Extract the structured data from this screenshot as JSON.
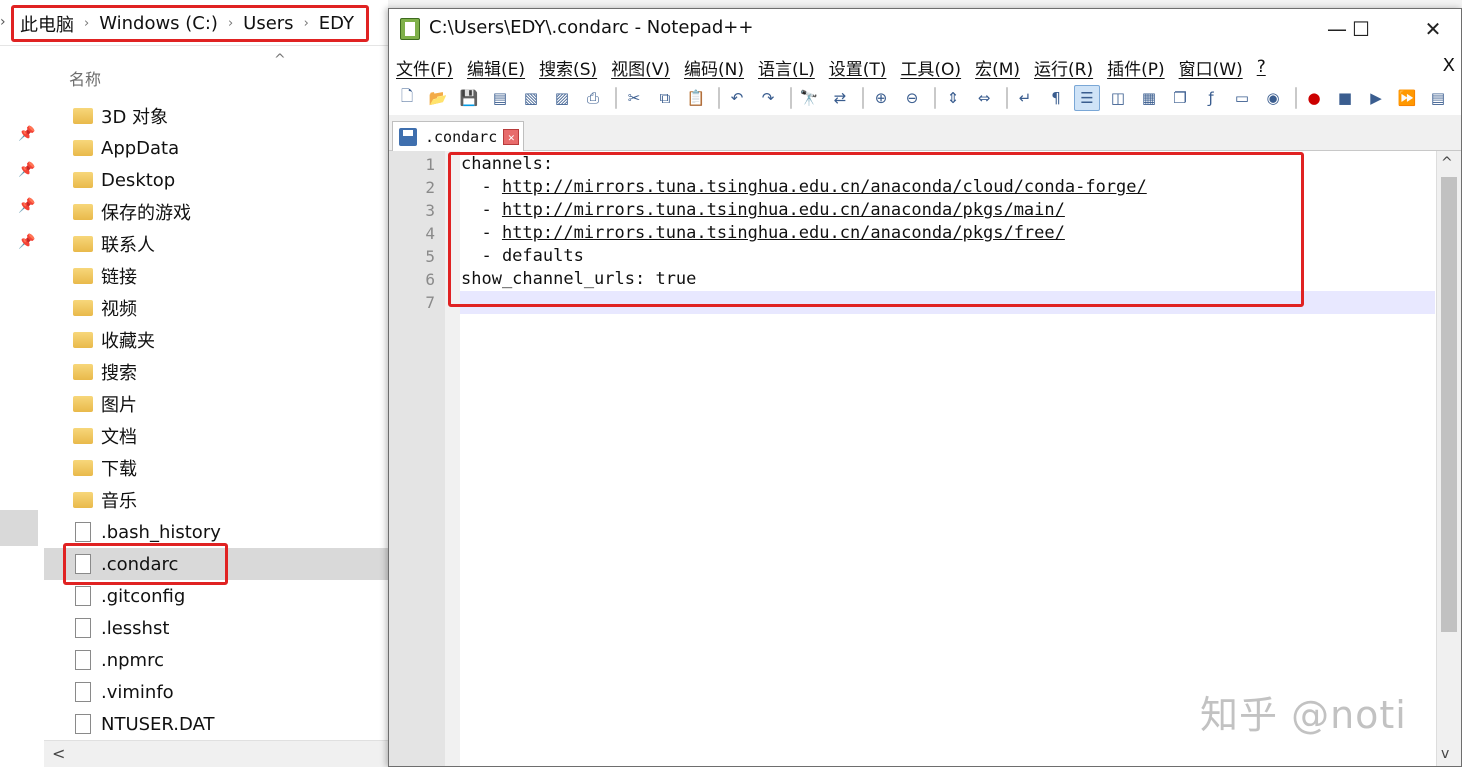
{
  "explorer": {
    "breadcrumb": [
      "此电脑",
      "Windows (C:)",
      "Users",
      "EDY"
    ],
    "column_header": "名称",
    "files": [
      {
        "name": "3D 对象",
        "icon": "3d-objects-folder-icon"
      },
      {
        "name": "AppData",
        "icon": "folder-icon"
      },
      {
        "name": "Desktop",
        "icon": "desktop-folder-icon"
      },
      {
        "name": "保存的游戏",
        "icon": "saved-games-folder-icon"
      },
      {
        "name": "联系人",
        "icon": "contacts-folder-icon"
      },
      {
        "name": "链接",
        "icon": "links-folder-icon"
      },
      {
        "name": "视频",
        "icon": "videos-folder-icon"
      },
      {
        "name": "收藏夹",
        "icon": "favorites-folder-icon"
      },
      {
        "name": "搜索",
        "icon": "searches-folder-icon"
      },
      {
        "name": "图片",
        "icon": "pictures-folder-icon"
      },
      {
        "name": "文档",
        "icon": "documents-folder-icon"
      },
      {
        "name": "下载",
        "icon": "downloads-folder-icon"
      },
      {
        "name": "音乐",
        "icon": "music-folder-icon"
      },
      {
        "name": ".bash_history",
        "icon": "file-icon"
      },
      {
        "name": ".condarc",
        "icon": "file-icon",
        "selected": true
      },
      {
        "name": ".gitconfig",
        "icon": "file-icon"
      },
      {
        "name": ".lesshst",
        "icon": "file-icon"
      },
      {
        "name": ".npmrc",
        "icon": "file-icon"
      },
      {
        "name": ".viminfo",
        "icon": "file-icon"
      },
      {
        "name": "NTUSER.DAT",
        "icon": "file-icon"
      }
    ]
  },
  "npp": {
    "title": "C:\\Users\\EDY\\.condarc - Notepad++",
    "menu": [
      "文件(F)",
      "编辑(E)",
      "搜索(S)",
      "视图(V)",
      "编码(N)",
      "语言(L)",
      "设置(T)",
      "工具(O)",
      "宏(M)",
      "运行(R)",
      "插件(P)",
      "窗口(W)",
      "?"
    ],
    "menu_close": "X",
    "tab_label": ".condarc",
    "line_numbers": [
      "1",
      "2",
      "3",
      "4",
      "5",
      "6",
      "7"
    ],
    "lines": [
      {
        "prefix": "channels:",
        "link": ""
      },
      {
        "prefix": "  - ",
        "link": "http://mirrors.tuna.tsinghua.edu.cn/anaconda/cloud/conda-forge/"
      },
      {
        "prefix": "  - ",
        "link": "http://mirrors.tuna.tsinghua.edu.cn/anaconda/pkgs/main/"
      },
      {
        "prefix": "  - ",
        "link": "http://mirrors.tuna.tsinghua.edu.cn/anaconda/pkgs/free/"
      },
      {
        "prefix": "  - defaults",
        "link": ""
      },
      {
        "prefix": "show_channel_urls: true",
        "link": ""
      },
      {
        "prefix": "",
        "link": ""
      }
    ]
  },
  "watermark": "知乎 @noti"
}
